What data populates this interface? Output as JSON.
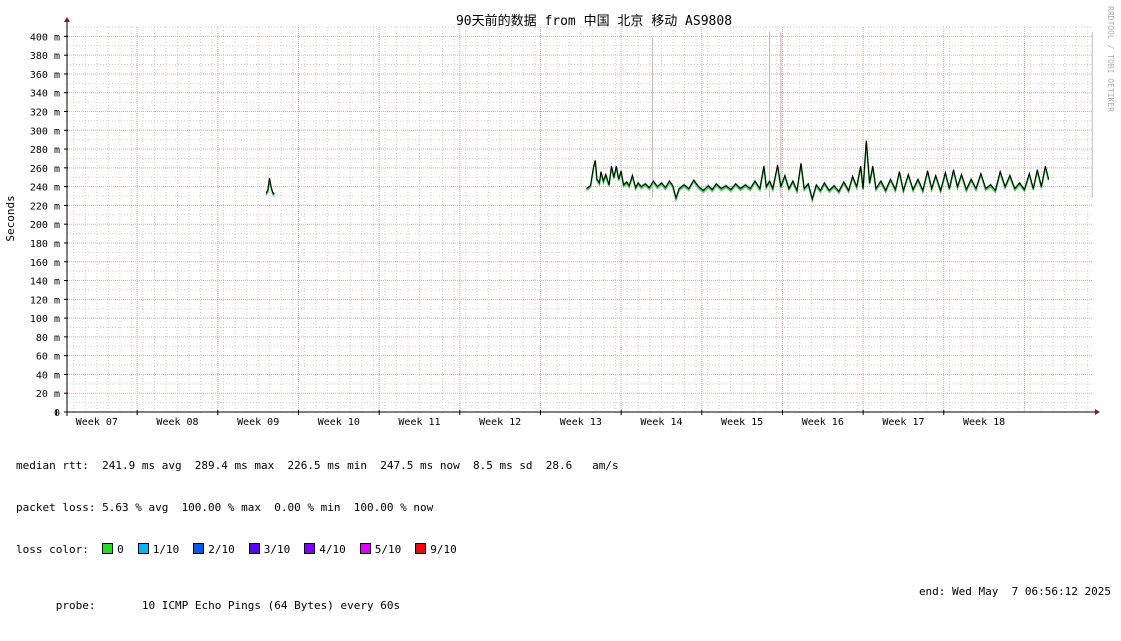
{
  "chart_data": {
    "type": "line",
    "title": "90天前的数据 from 中国 北京 移动 AS9808",
    "ylabel": "Seconds",
    "watermark": "RRDTOOL / TOBI OETIKER",
    "ylim": [
      0,
      410
    ],
    "yticks": [
      {
        "v": 0,
        "label": "0"
      },
      {
        "v": 20,
        "label": "20 m"
      },
      {
        "v": 40,
        "label": "40 m"
      },
      {
        "v": 60,
        "label": "60 m"
      },
      {
        "v": 80,
        "label": "80 m"
      },
      {
        "v": 100,
        "label": "100 m"
      },
      {
        "v": 120,
        "label": "120 m"
      },
      {
        "v": 140,
        "label": "140 m"
      },
      {
        "v": 160,
        "label": "160 m"
      },
      {
        "v": 180,
        "label": "180 m"
      },
      {
        "v": 200,
        "label": "200 m"
      },
      {
        "v": 220,
        "label": "220 m"
      },
      {
        "v": 240,
        "label": "240 m"
      },
      {
        "v": 260,
        "label": "260 m"
      },
      {
        "v": 280,
        "label": "280 m"
      },
      {
        "v": 300,
        "label": "300 m"
      },
      {
        "v": 320,
        "label": "320 m"
      },
      {
        "v": 340,
        "label": "340 m"
      },
      {
        "v": 360,
        "label": "360 m"
      },
      {
        "v": 380,
        "label": "380 m"
      },
      {
        "v": 400,
        "label": "400 m"
      }
    ],
    "x_unit": "week",
    "xlim": [
      6.63,
      19.35
    ],
    "xticks": [
      {
        "v": 7,
        "label": "Week 07"
      },
      {
        "v": 8,
        "label": "Week 08"
      },
      {
        "v": 9,
        "label": "Week 09"
      },
      {
        "v": 10,
        "label": "Week 10"
      },
      {
        "v": 11,
        "label": "Week 11"
      },
      {
        "v": 12,
        "label": "Week 12"
      },
      {
        "v": 13,
        "label": "Week 13"
      },
      {
        "v": 14,
        "label": "Week 14"
      },
      {
        "v": 15,
        "label": "Week 15"
      },
      {
        "v": 16,
        "label": "Week 16"
      },
      {
        "v": 17,
        "label": "Week 17"
      },
      {
        "v": 18,
        "label": "Week 18"
      }
    ],
    "day_grid_step": 0.142857,
    "grid": true,
    "series": [
      {
        "name": "median rtt",
        "color": "#000000",
        "segments": [
          [
            [
              9.1,
              233
            ],
            [
              9.12,
              236
            ],
            [
              9.14,
              249
            ],
            [
              9.16,
              240
            ],
            [
              9.18,
              234
            ],
            [
              9.2,
              232
            ]
          ],
          [
            [
              13.07,
              238
            ],
            [
              13.12,
              241
            ],
            [
              13.16,
              262
            ],
            [
              13.18,
              268
            ],
            [
              13.2,
              248
            ],
            [
              13.23,
              244
            ],
            [
              13.25,
              256
            ],
            [
              13.28,
              246
            ],
            [
              13.31,
              253
            ],
            [
              13.35,
              242
            ],
            [
              13.38,
              262
            ],
            [
              13.41,
              250
            ],
            [
              13.44,
              262
            ],
            [
              13.47,
              248
            ],
            [
              13.5,
              257
            ],
            [
              13.53,
              242
            ],
            [
              13.57,
              245
            ],
            [
              13.6,
              241
            ],
            [
              13.64,
              252
            ],
            [
              13.68,
              239
            ],
            [
              13.71,
              244
            ],
            [
              13.75,
              240
            ],
            [
              13.8,
              243
            ],
            [
              13.85,
              239
            ],
            [
              13.9,
              246
            ],
            [
              13.95,
              240
            ],
            [
              14.0,
              244
            ],
            [
              14.05,
              239
            ],
            [
              14.1,
              246
            ],
            [
              14.14,
              241
            ],
            [
              14.18,
              228
            ],
            [
              14.22,
              238
            ],
            [
              14.28,
              242
            ],
            [
              14.34,
              238
            ],
            [
              14.4,
              247
            ],
            [
              14.46,
              240
            ],
            [
              14.52,
              236
            ],
            [
              14.58,
              241
            ],
            [
              14.63,
              237
            ],
            [
              14.68,
              243
            ],
            [
              14.74,
              238
            ],
            [
              14.8,
              241
            ],
            [
              14.86,
              237
            ],
            [
              14.92,
              243
            ],
            [
              14.98,
              238
            ],
            [
              15.04,
              242
            ],
            [
              15.1,
              238
            ],
            [
              15.16,
              246
            ],
            [
              15.22,
              238
            ],
            [
              15.27,
              262
            ],
            [
              15.3,
              240
            ],
            [
              15.34,
              246
            ],
            [
              15.38,
              238
            ],
            [
              15.44,
              263
            ],
            [
              15.48,
              240
            ],
            [
              15.53,
              252
            ],
            [
              15.58,
              238
            ],
            [
              15.63,
              246
            ],
            [
              15.68,
              236
            ],
            [
              15.73,
              265
            ],
            [
              15.77,
              238
            ],
            [
              15.82,
              243
            ],
            [
              15.87,
              227
            ],
            [
              15.92,
              242
            ],
            [
              15.97,
              236
            ],
            [
              16.02,
              244
            ],
            [
              16.08,
              236
            ],
            [
              16.14,
              241
            ],
            [
              16.2,
              235
            ],
            [
              16.26,
              245
            ],
            [
              16.32,
              236
            ],
            [
              16.37,
              251
            ],
            [
              16.42,
              240
            ],
            [
              16.47,
              262
            ],
            [
              16.5,
              238
            ],
            [
              16.54,
              289
            ],
            [
              16.58,
              244
            ],
            [
              16.62,
              262
            ],
            [
              16.66,
              238
            ],
            [
              16.72,
              246
            ],
            [
              16.78,
              236
            ],
            [
              16.84,
              248
            ],
            [
              16.9,
              237
            ],
            [
              16.95,
              256
            ],
            [
              17.0,
              236
            ],
            [
              17.06,
              253
            ],
            [
              17.12,
              237
            ],
            [
              17.18,
              248
            ],
            [
              17.24,
              236
            ],
            [
              17.3,
              257
            ],
            [
              17.35,
              238
            ],
            [
              17.4,
              252
            ],
            [
              17.46,
              236
            ],
            [
              17.52,
              255
            ],
            [
              17.57,
              238
            ],
            [
              17.62,
              258
            ],
            [
              17.67,
              240
            ],
            [
              17.72,
              253
            ],
            [
              17.78,
              237
            ],
            [
              17.84,
              248
            ],
            [
              17.9,
              238
            ],
            [
              17.96,
              254
            ],
            [
              18.02,
              238
            ],
            [
              18.08,
              242
            ],
            [
              18.14,
              236
            ],
            [
              18.2,
              256
            ],
            [
              18.26,
              240
            ],
            [
              18.32,
              252
            ],
            [
              18.38,
              238
            ],
            [
              18.44,
              244
            ],
            [
              18.5,
              237
            ],
            [
              18.56,
              254
            ],
            [
              18.61,
              238
            ],
            [
              18.66,
              258
            ],
            [
              18.71,
              240
            ],
            [
              18.76,
              262
            ],
            [
              18.8,
              248
            ]
          ]
        ]
      }
    ],
    "spikes": [
      {
        "x": 13.89,
        "top": 398
      },
      {
        "x": 15.34,
        "top": 405
      },
      {
        "x": 15.48,
        "top": 405
      },
      {
        "x": 19.34,
        "top": 405
      }
    ]
  },
  "legend": {
    "median_rtt_line": "median rtt:  241.9 ms avg  289.4 ms max  226.5 ms min  247.5 ms now  8.5 ms sd  28.6   am/s",
    "packet_loss_line": "packet loss: 5.63 % avg  100.00 % max  0.00 % min  100.00 % now",
    "loss_color_label": "loss color:",
    "loss_colors": [
      {
        "label": "0",
        "color": "#22dd22"
      },
      {
        "label": "1/10",
        "color": "#00b8ff"
      },
      {
        "label": "2/10",
        "color": "#0059ff"
      },
      {
        "label": "3/10",
        "color": "#5e00ff"
      },
      {
        "label": "4/10",
        "color": "#7e00ff"
      },
      {
        "label": "5/10",
        "color": "#dd00ff"
      },
      {
        "label": "9/10",
        "color": "#ff0000"
      }
    ],
    "probe_line": "probe:       10 ICMP Echo Pings (64 Bytes) every 60s",
    "end_line": "end: Wed May  7 06:56:12 2025"
  }
}
